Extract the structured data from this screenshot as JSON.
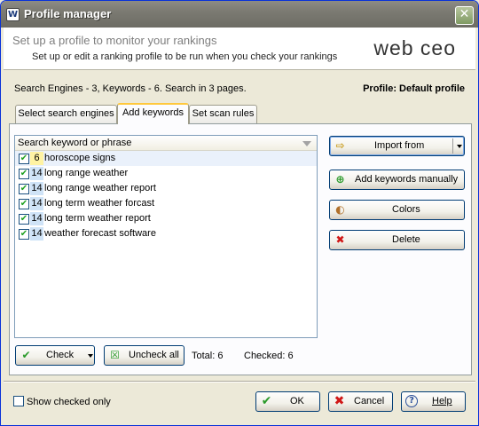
{
  "window": {
    "title": "Profile manager",
    "icon": "W"
  },
  "header": {
    "title": "Set up a profile to monitor your rankings",
    "subtitle": "Set up or edit a ranking profile to be run when you check your rankings",
    "logo": "web ceo"
  },
  "info": {
    "summary": "Search Engines - 3, Keywords - 6. Search in 3 pages.",
    "profile": "Profile: Default profile"
  },
  "tabs": [
    {
      "label": "Select search engines",
      "active": false
    },
    {
      "label": "Add keywords",
      "active": true
    },
    {
      "label": "Set scan rules",
      "active": false
    }
  ],
  "keyword_list": {
    "header": "Search keyword or phrase",
    "rows": [
      {
        "rank": "6",
        "keyword": "horoscope signs",
        "checked": true
      },
      {
        "rank": "14",
        "keyword": "long range weather",
        "checked": true
      },
      {
        "rank": "14",
        "keyword": "long range weather report",
        "checked": true
      },
      {
        "rank": "14",
        "keyword": "long term weather forcast",
        "checked": true
      },
      {
        "rank": "14",
        "keyword": "long term weather report",
        "checked": true
      },
      {
        "rank": "14",
        "keyword": "weather forecast software",
        "checked": true
      }
    ]
  },
  "actions": {
    "import": "Import from",
    "add_manual": "Add keywords manually",
    "colors": "Colors",
    "delete": "Delete"
  },
  "list_controls": {
    "check": "Check",
    "uncheck_all": "Uncheck all",
    "total": "Total: 6",
    "checked": "Checked: 6"
  },
  "footer": {
    "show_checked_only": "Show checked only",
    "ok": "OK",
    "cancel": "Cancel",
    "help": "Help"
  },
  "colors": {
    "rank_top": "#fff3a3",
    "rank_other": "#cfe3f7",
    "ok_icon": "#2a9a2a",
    "cancel_icon": "#d01818",
    "help_icon": "#2a4f9a"
  }
}
